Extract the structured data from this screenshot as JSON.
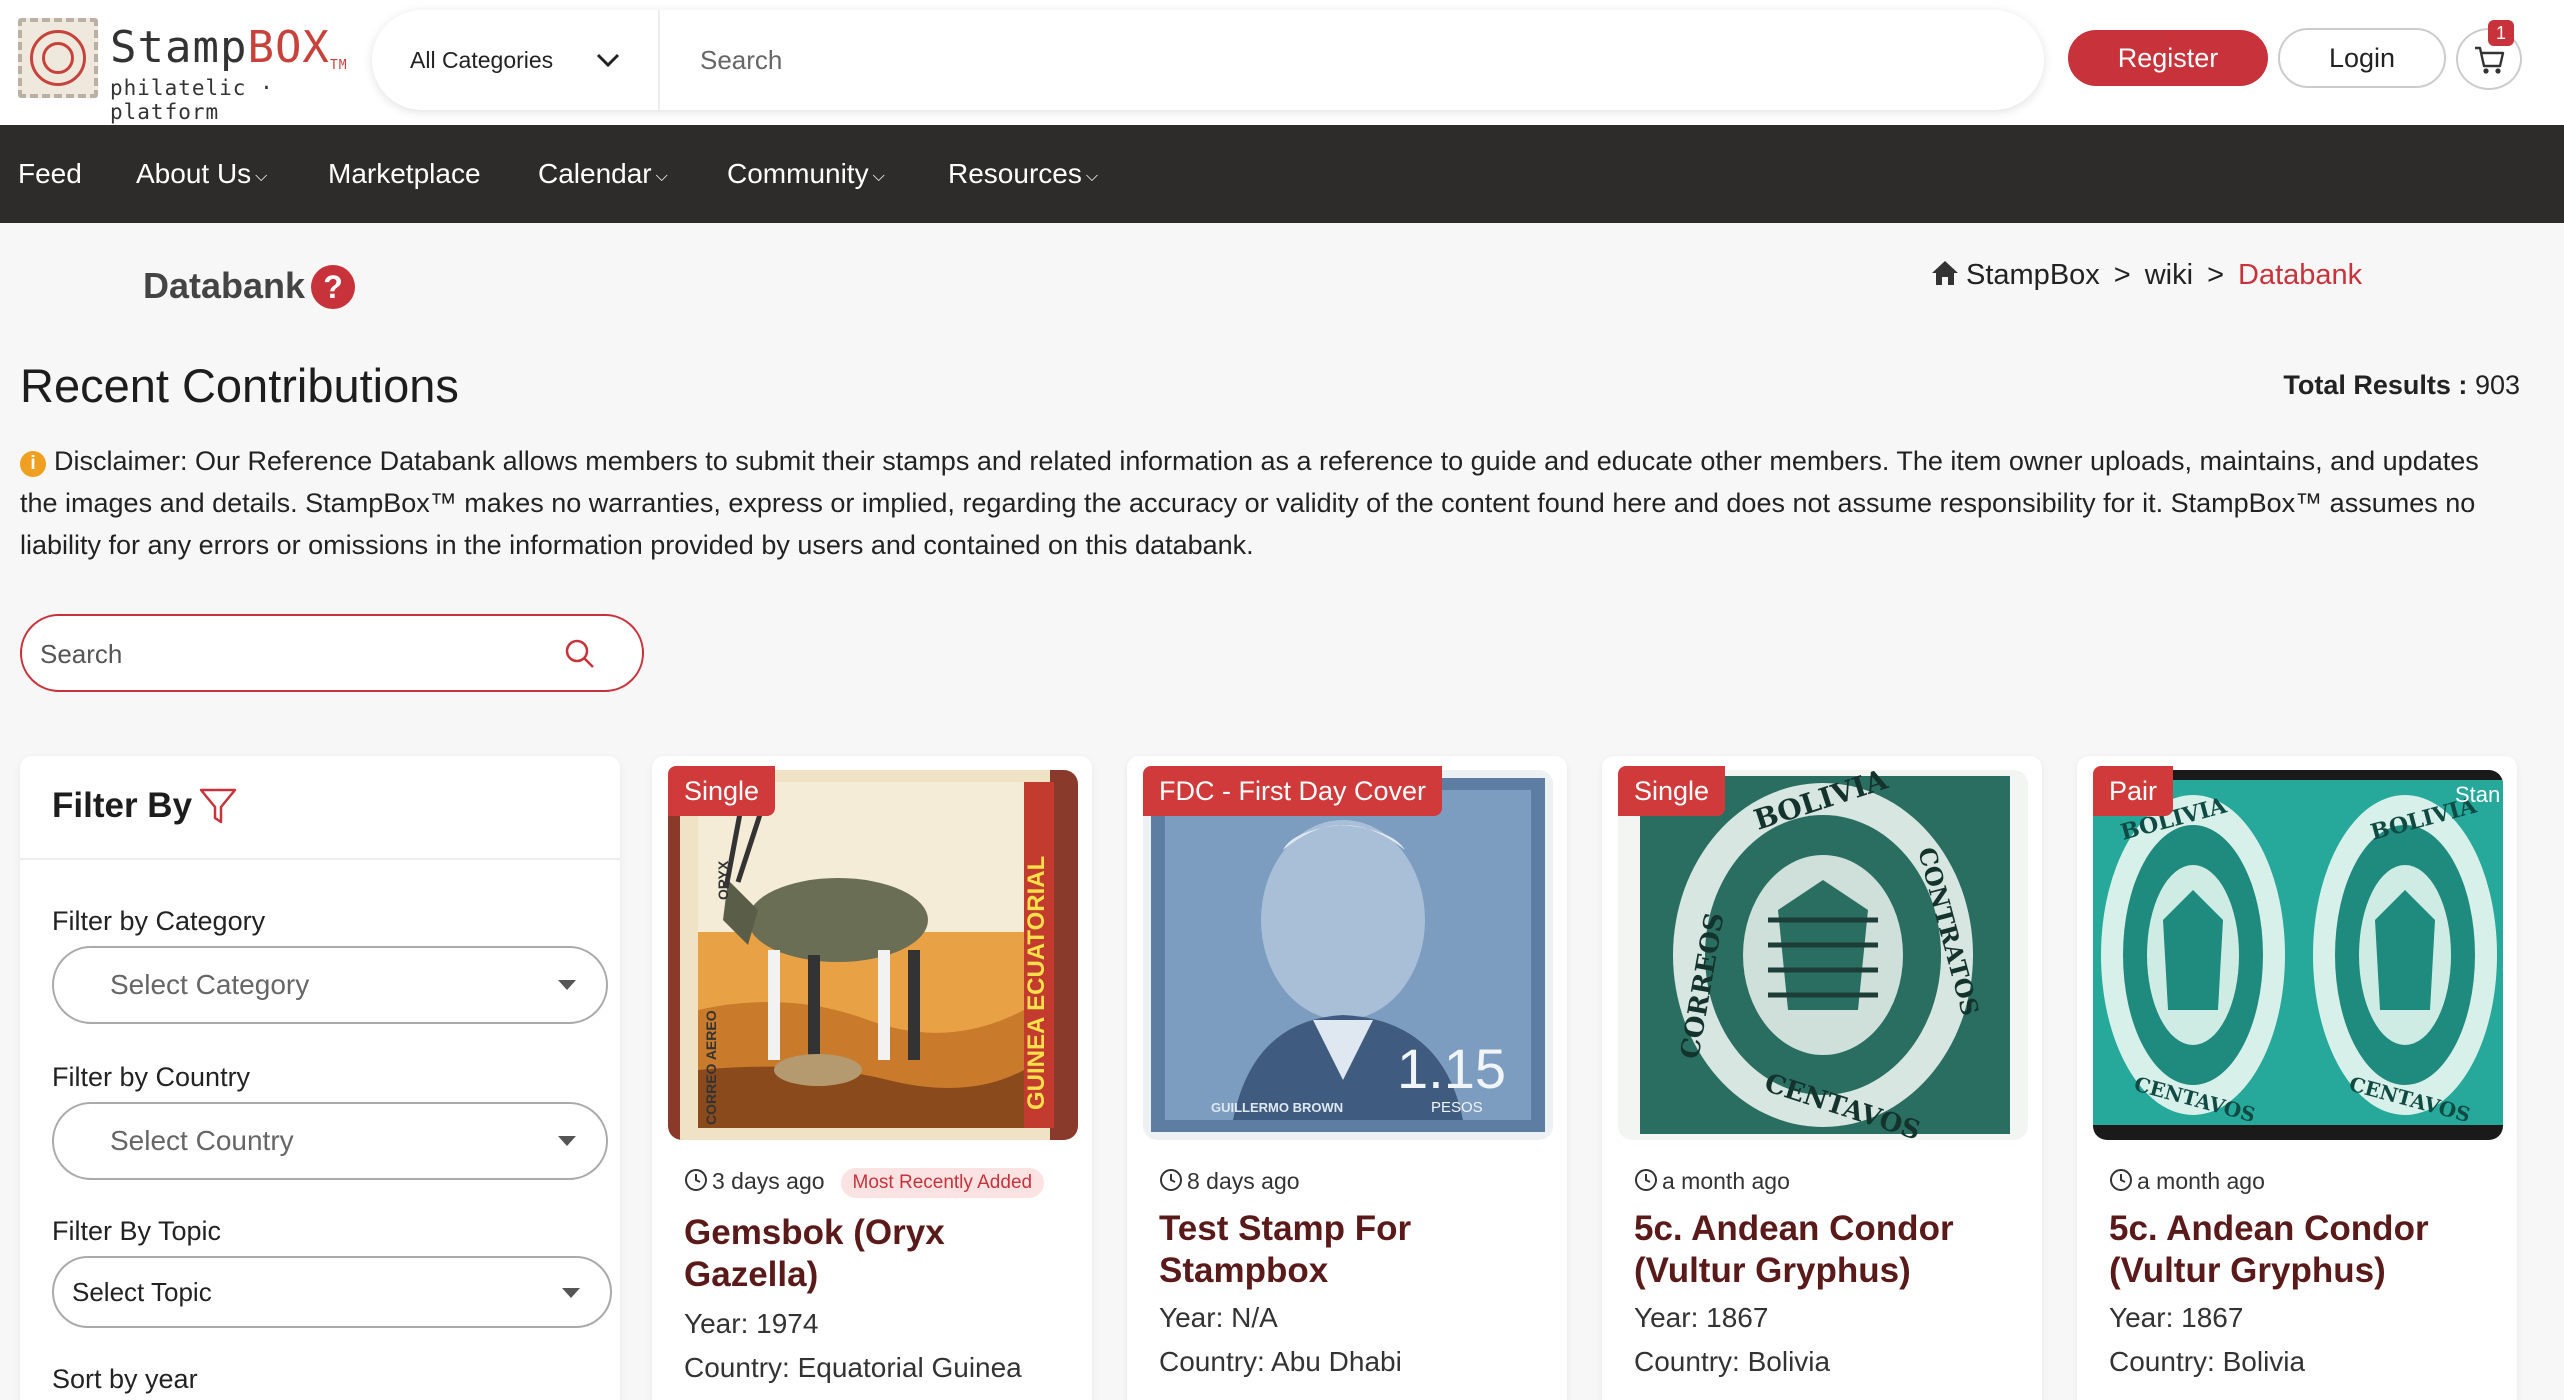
{
  "brand": {
    "name_main": "Stamp",
    "name_accent": "BOX",
    "tm": "TM",
    "tagline": "philatelic · platform"
  },
  "search": {
    "category": "All Categories",
    "placeholder": "Search"
  },
  "header": {
    "register_label": "Register",
    "login_label": "Login",
    "cart_count": "1"
  },
  "nav": {
    "items": [
      {
        "label": "Feed",
        "has_caret": false
      },
      {
        "label": "About Us",
        "has_caret": true
      },
      {
        "label": "Marketplace",
        "has_caret": false
      },
      {
        "label": "Calendar",
        "has_caret": true
      },
      {
        "label": "Community",
        "has_caret": true
      },
      {
        "label": "Resources",
        "has_caret": true
      }
    ],
    "caret": "⌵"
  },
  "page": {
    "title": "Databank",
    "help_glyph": "?",
    "breadcrumb": [
      "StampBox",
      "wiki",
      "Databank"
    ],
    "breadcrumb_sep": ">",
    "section_title": "Recent Contributions",
    "total_label": "Total Results :",
    "total_value": "903",
    "info_glyph": "i",
    "disclaimer": "Disclaimer: Our Reference Databank allows members to submit their stamps and related information as a reference to guide and educate other members. The item owner uploads, maintains, and updates the images and details. StampBox™ makes no warranties, express or implied, regarding the accuracy or validity of the content found here and does not assume responsibility for it. StampBox™ assumes no liability for any errors or omissions in the information provided by users and contained on this databank.",
    "db_search_placeholder": "Search"
  },
  "filter": {
    "title": "Filter By",
    "category_label": "Filter by Category",
    "category_value": "Select Category",
    "country_label": "Filter by Country",
    "country_value": "Select Country",
    "topic_label": "Filter By Topic",
    "topic_value": "Select Topic",
    "sort_label": "Sort by year"
  },
  "cards": [
    {
      "badge": "Single",
      "time": "3 days ago",
      "pill": "Most Recently Added",
      "title": "Gemsbok (Oryx Gazella)",
      "year": "Year: 1974",
      "country": "Country: Equatorial Guinea",
      "stamp_text": "ORYX",
      "stamp_side": "GUINEA ECUATORIAL",
      "stamp_side_left": "CORREO AEREO"
    },
    {
      "badge": "FDC - First Day Cover",
      "time": "8 days ago",
      "title": "Test Stamp For Stampbox",
      "year": "Year: N/A",
      "country": "Country: Abu Dhabi",
      "stamp_name": "GUILLERMO BROWN",
      "stamp_value": "1.15",
      "stamp_unit": "PESOS"
    },
    {
      "badge": "Single",
      "time": "a month ago",
      "title": "5c. Andean Condor (Vultur Gryphus)",
      "year": "Year: 1867",
      "country": "Country: Bolivia",
      "stamp_top": "BOLIVIA",
      "stamp_left": "CORREOS",
      "stamp_right": "CONTRATOS",
      "stamp_bottom": "CENTAVOS"
    },
    {
      "badge": "Pair",
      "time": "a month ago",
      "title": "5c. Andean Condor (Vultur Gryphus)",
      "year": "Year: 1867",
      "country": "Country: Bolivia",
      "stamp_top": "BOLIVIA",
      "stamp_bottom": "CENTAVOS",
      "watermark": "Stan"
    }
  ],
  "colors": {
    "accent": "#c8323a",
    "nav_bg": "#2e2c2a",
    "title_brown": "#5a1a1a"
  }
}
